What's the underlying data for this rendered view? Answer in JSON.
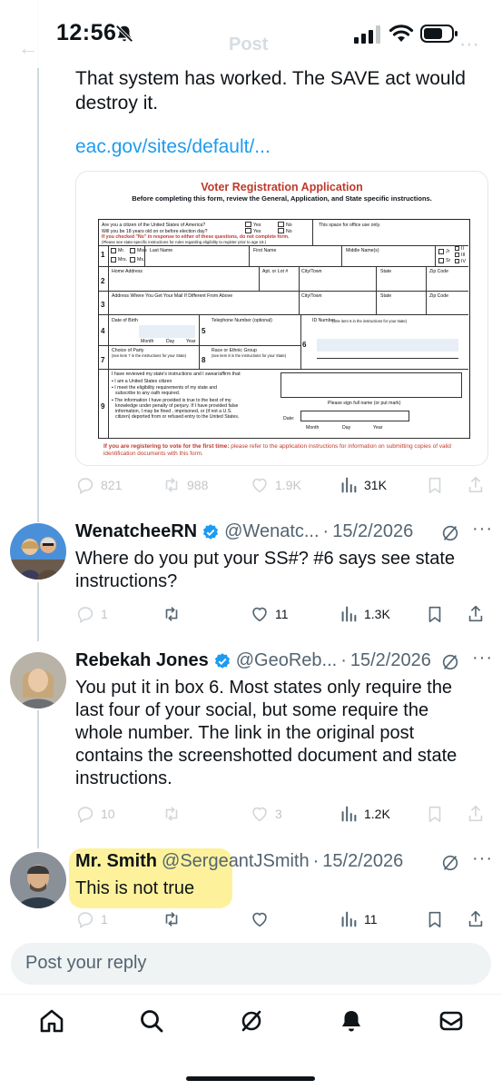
{
  "status_bar": {
    "time": "12:56",
    "ghost_title": "Post",
    "ghost_back": "←",
    "ghost_more": "⋯"
  },
  "main_post": {
    "text": "That system has worked. The SAVE act would destroy it.",
    "link": "eac.gov/sites/default/...",
    "form": {
      "title": "Voter Registration Application",
      "subtitle": "Before completing this form, review the General, Application, and State specific instructions.",
      "q1": "Are you a citizen of the United States of America?",
      "q2": "Will you be 18 years old on or before election day?",
      "warn": "If you checked \"No\" in response to either of these questions, do not complete form.",
      "see_state": "(Please see state-specific instructions for rules regarding eligibility to register prior to age 18.)",
      "yes": "Yes",
      "no": "No",
      "office": "This space for office use only.",
      "mr": "Mr.",
      "miss": "Miss",
      "mrs": "Mrs.",
      "ms": "Ms.",
      "last_name": "Last Name",
      "first_name": "First Name",
      "middle_name": "Middle Name(s)",
      "jr": "Jr",
      "sr": "Sr",
      "ii": "II",
      "iii": "III",
      "iv": "IV",
      "home_address": "Home Address",
      "apt": "Apt. or Lot #",
      "city": "City/Town",
      "state": "State",
      "zip": "Zip Code",
      "mail_address": "Address Where You Get Your Mail If Different From Above",
      "dob": "Date of Birth",
      "month": "Month",
      "day": "Day",
      "year": "Year",
      "phone": "Telephone Number (optional)",
      "id_number": "ID Number -",
      "id_note": "(See item 6 in the instructions for your state)",
      "party": "Choice of Party",
      "party_note": "(see item 7 in the instructions for your State)",
      "race": "Race or Ethnic Group",
      "race_note": "(see item 8 in the instructions for your State)",
      "affirm_intro": "I have reviewed my state's instructions and I swear/affirm that:",
      "affirm_1": "I am a United States citizen",
      "affirm_2a": "I meet the eligibility requirements of my state and",
      "affirm_2b": "subscribe to any oath required.",
      "affirm_3a": "The information I have provided is true to the best of my",
      "affirm_3b": "knowledge under penalty of perjury. If I have provided false",
      "affirm_3c": "information, I may be fined , imprisoned, or (if not a U.S.",
      "affirm_3d": "citizen) deported from or refused entry to the United States.",
      "sign": "Please sign full name (or put mark)",
      "date": "Date:",
      "foot_bold": "If you are registering to vote for the first time:",
      "foot_rest": " please refer to the application instructions for information on submitting copies of valid identification documents with this form."
    },
    "stats": {
      "replies": "821",
      "reposts": "988",
      "likes": "1.9K",
      "views": "31K"
    }
  },
  "replies": [
    {
      "name": "WenatcheeRN",
      "handle": "@Wenatc...",
      "sep": "·",
      "date": "15/2/2026",
      "text": "Where do you put your SS#? #6 says see state instructions?",
      "replies": "1",
      "reposts": "",
      "likes": "11",
      "views": "1.3K"
    },
    {
      "name": "Rebekah Jones",
      "handle": "@GeoReb...",
      "sep": "·",
      "date": "15/2/2026",
      "text": "You put it in box 6.  Most states only require the last four of your social, but some require the whole number. The link in the original post contains the screenshotted document and state instructions.",
      "replies": "10",
      "reposts": "",
      "likes": "3",
      "views": "1.2K"
    },
    {
      "name": "Mr. Smith",
      "handle": "@SergeantJSmith",
      "sep": "·",
      "date": "15/2/2026",
      "text": "This is not true",
      "replies": "1",
      "reposts": "",
      "likes": "",
      "views": "11"
    }
  ],
  "more_glyph": "···",
  "reply_placeholder": "Post your reply",
  "colors": {
    "accent": "#1d9bf0",
    "verified": "#1d9bf0",
    "highlight": "#fdf08a",
    "form_red": "#c0392b"
  }
}
